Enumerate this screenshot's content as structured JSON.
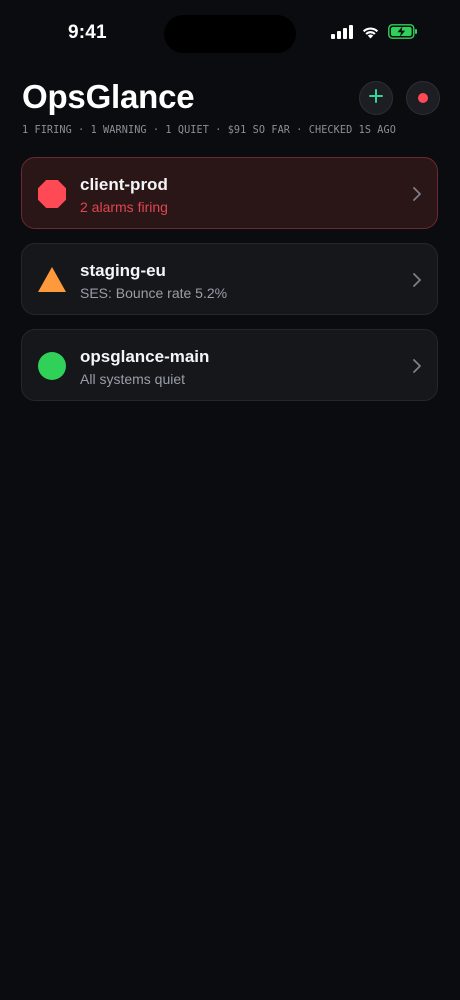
{
  "status_bar": {
    "time": "9:41"
  },
  "header": {
    "title": "OpsGlance",
    "summary": "1 FIRING · 1 WARNING · 1 QUIET · $91 SO FAR · CHECKED 1S AGO"
  },
  "accounts": [
    {
      "name": "client-prod",
      "status": "alarm",
      "subtitle": "2 alarms firing",
      "icon": "octagon-icon"
    },
    {
      "name": "staging-eu",
      "status": "warning",
      "subtitle": "SES: Bounce rate 5.2%",
      "icon": "triangle-icon"
    },
    {
      "name": "opsglance-main",
      "status": "ok",
      "subtitle": "All systems quiet",
      "icon": "circle-icon"
    }
  ],
  "colors": {
    "alarm": "#ff4a55",
    "warning": "#ff9a3c",
    "ok": "#30d158",
    "accent": "#34d399",
    "background": "#0b0c0f"
  }
}
